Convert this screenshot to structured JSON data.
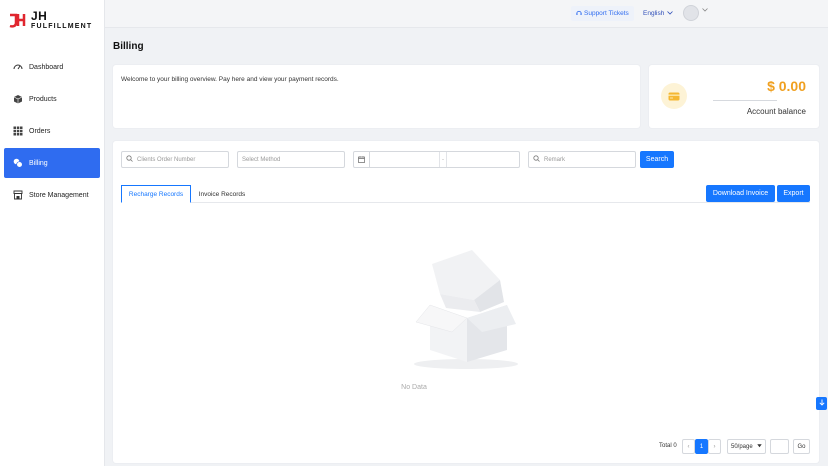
{
  "brand": {
    "logo_main": "JH",
    "logo_sub": "FULFILLMENT"
  },
  "sidebar": {
    "items": [
      {
        "label": "Dashboard",
        "icon": "gauge-icon"
      },
      {
        "label": "Products",
        "icon": "box-icon"
      },
      {
        "label": "Orders",
        "icon": "grid-icon"
      },
      {
        "label": "Billing",
        "icon": "coins-icon",
        "active": true
      },
      {
        "label": "Store Management",
        "icon": "store-icon"
      }
    ]
  },
  "header": {
    "support_label": "Support Tickets",
    "language": "English"
  },
  "page": {
    "title": "Billing",
    "welcome_text": "Welcome to your billing overview. Pay here and view your payment records."
  },
  "balance": {
    "amount": "$ 0.00",
    "label": "Account balance"
  },
  "filters": {
    "order_placeholder": "Clients Order Number",
    "method_placeholder": "Select Method",
    "date_separator": "-",
    "remark_placeholder": "Remark",
    "search_label": "Search"
  },
  "tabs": [
    {
      "label": "Recharge Records",
      "active": true
    },
    {
      "label": "Invoice Records"
    }
  ],
  "actions": {
    "download_label": "Download Invoice",
    "export_label": "Export"
  },
  "empty": {
    "text": "No Data"
  },
  "pagination": {
    "total": "Total 0",
    "current_page": "1",
    "page_size": "50/page",
    "go_label": "Go",
    "prev": "‹",
    "next": "›"
  },
  "colors": {
    "primary": "#1677ff",
    "active_nav": "#2f6cf0",
    "balance": "#f0a020",
    "logo_red": "#e0262f"
  }
}
